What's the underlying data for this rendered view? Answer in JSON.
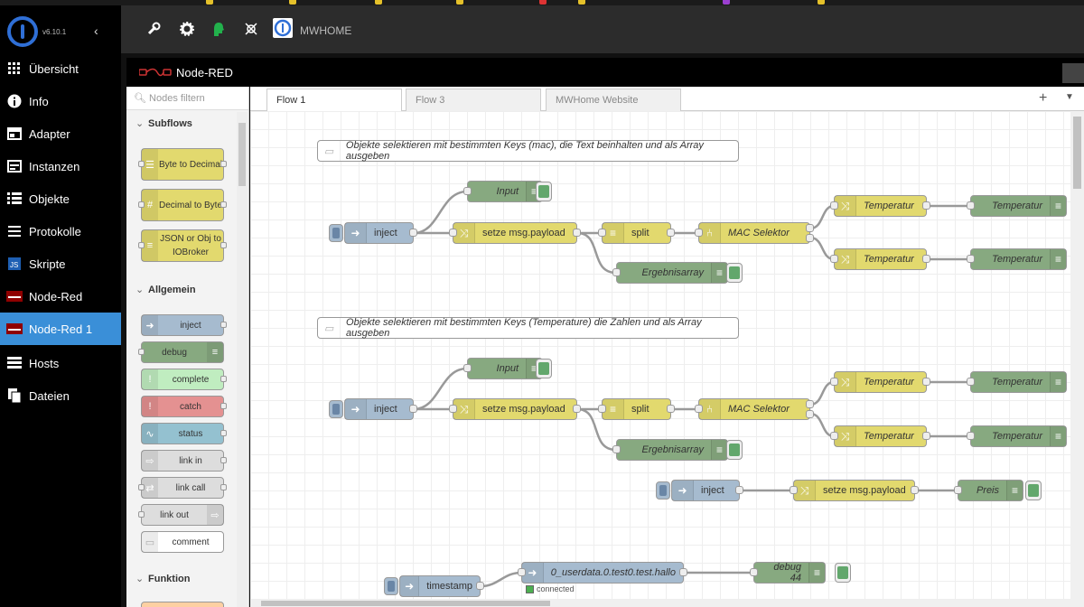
{
  "app": {
    "version": "v6.10.1"
  },
  "sidebar": {
    "items": [
      {
        "label": "Übersicht",
        "icon": "grid-icon",
        "active": false
      },
      {
        "label": "Info",
        "icon": "info-icon",
        "active": false
      },
      {
        "label": "Adapter",
        "icon": "store-icon",
        "active": false
      },
      {
        "label": "Instanzen",
        "icon": "instances-icon",
        "active": false
      },
      {
        "label": "Objekte",
        "icon": "list-icon",
        "active": false
      },
      {
        "label": "Protokolle",
        "icon": "log-icon",
        "active": false
      },
      {
        "label": "Skripte",
        "icon": "js-icon",
        "active": false
      },
      {
        "label": "Node-Red",
        "icon": "nodered-icon",
        "active": false
      },
      {
        "label": "Node-Red 1",
        "icon": "nodered-icon",
        "active": true
      },
      {
        "label": "Hosts",
        "icon": "hosts-icon",
        "active": false
      },
      {
        "label": "Dateien",
        "icon": "files-icon",
        "active": false
      }
    ]
  },
  "topbar": {
    "host_label": "MWHOME",
    "tools": [
      "wrench-icon",
      "gear-icon",
      "user-head-icon",
      "sync-icon"
    ]
  },
  "nodered": {
    "title": "Node-RED",
    "filter_placeholder": "Nodes filtern"
  },
  "palette": {
    "categories": [
      {
        "label": "Subflows"
      },
      {
        "label": "Allgemein"
      },
      {
        "label": "Funktion"
      }
    ],
    "subflows": [
      {
        "label": "Byte to Decimal"
      },
      {
        "label": "Decimal to Byte"
      },
      {
        "label": "JSON or Obj to IOBroker"
      }
    ],
    "general": [
      {
        "label": "inject"
      },
      {
        "label": "debug"
      },
      {
        "label": "complete"
      },
      {
        "label": "catch"
      },
      {
        "label": "status"
      },
      {
        "label": "link in"
      },
      {
        "label": "link call"
      },
      {
        "label": "link out"
      },
      {
        "label": "comment"
      }
    ]
  },
  "tabs": [
    {
      "label": "Flow 1",
      "active": true
    },
    {
      "label": "Flow 3",
      "active": false
    },
    {
      "label": "MWHome Website",
      "active": false
    }
  ],
  "flow": {
    "comments": [
      "Objekte selektieren mit bestimmten Keys (mac), die Text beinhalten und als Array ausgeben",
      "Objekte selektieren mit bestimmten Keys (Temperature) die Zahlen und als Array ausgeben"
    ],
    "group1": {
      "inject": "inject",
      "input": "Input",
      "change": "setze msg.payload",
      "split": "split",
      "selector": "MAC Selektor",
      "ergebnis": "Ergebnisarray",
      "temp_change_1": "Temperatur",
      "temp_change_2": "Temperatur",
      "temp_out_1": "Temperatur",
      "temp_out_2": "Temperatur"
    },
    "group2": {
      "inject": "inject",
      "input": "Input",
      "change": "setze msg.payload",
      "split": "split",
      "selector": "MAC Selektor",
      "ergebnis": "Ergebnisarray",
      "temp_change_1": "Temperatur",
      "temp_change_2": "Temperatur",
      "temp_out_1": "Temperatur",
      "temp_out_2": "Temperatur"
    },
    "group3": {
      "inject": "inject",
      "change": "setze msg.payload",
      "out": "Preis"
    },
    "group4": {
      "inject": "timestamp",
      "iobroker_out": "0_userdata.0.test0.test.hallo",
      "status": "connected",
      "debug": "debug 44"
    }
  },
  "colors": {
    "inject": "#a6bbcf",
    "change": "#e2d96e",
    "debug": "#87a980",
    "switch": "#e2d96e",
    "active_nav": "#3a8fd8",
    "catch": "#e49191",
    "complete": "#c0edc0",
    "status": "#94c1d0",
    "link": "#dddddd"
  }
}
